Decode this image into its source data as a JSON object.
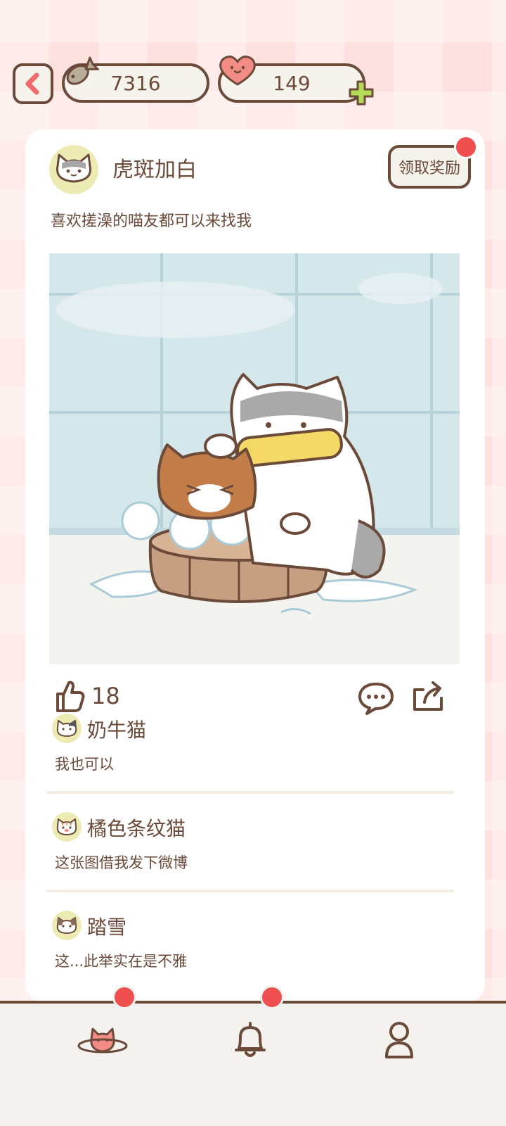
{
  "header": {
    "fish_count": "7316",
    "heart_count": "149"
  },
  "post": {
    "author": "虎斑加白",
    "reward_label": "领取奖励",
    "text": "喜欢搓澡的喵友都可以来找我",
    "like_count": "18"
  },
  "comments": [
    {
      "name": "奶牛猫",
      "text": "我也可以"
    },
    {
      "name": "橘色条纹猫",
      "text": "这张图借我发下微博"
    },
    {
      "name": "踏雪",
      "text": "这...此举实在是不雅"
    }
  ],
  "nav": {
    "items": [
      "planet-cat-icon",
      "bell-icon",
      "profile-icon"
    ],
    "badges": [
      true,
      true,
      false
    ]
  },
  "colors": {
    "brown": "#6b4a3a",
    "badge_red": "#ef4f4f",
    "plus_green": "#b5dc57",
    "heart_pink": "#f28c84",
    "avatar_bg": "#ecebb4"
  }
}
